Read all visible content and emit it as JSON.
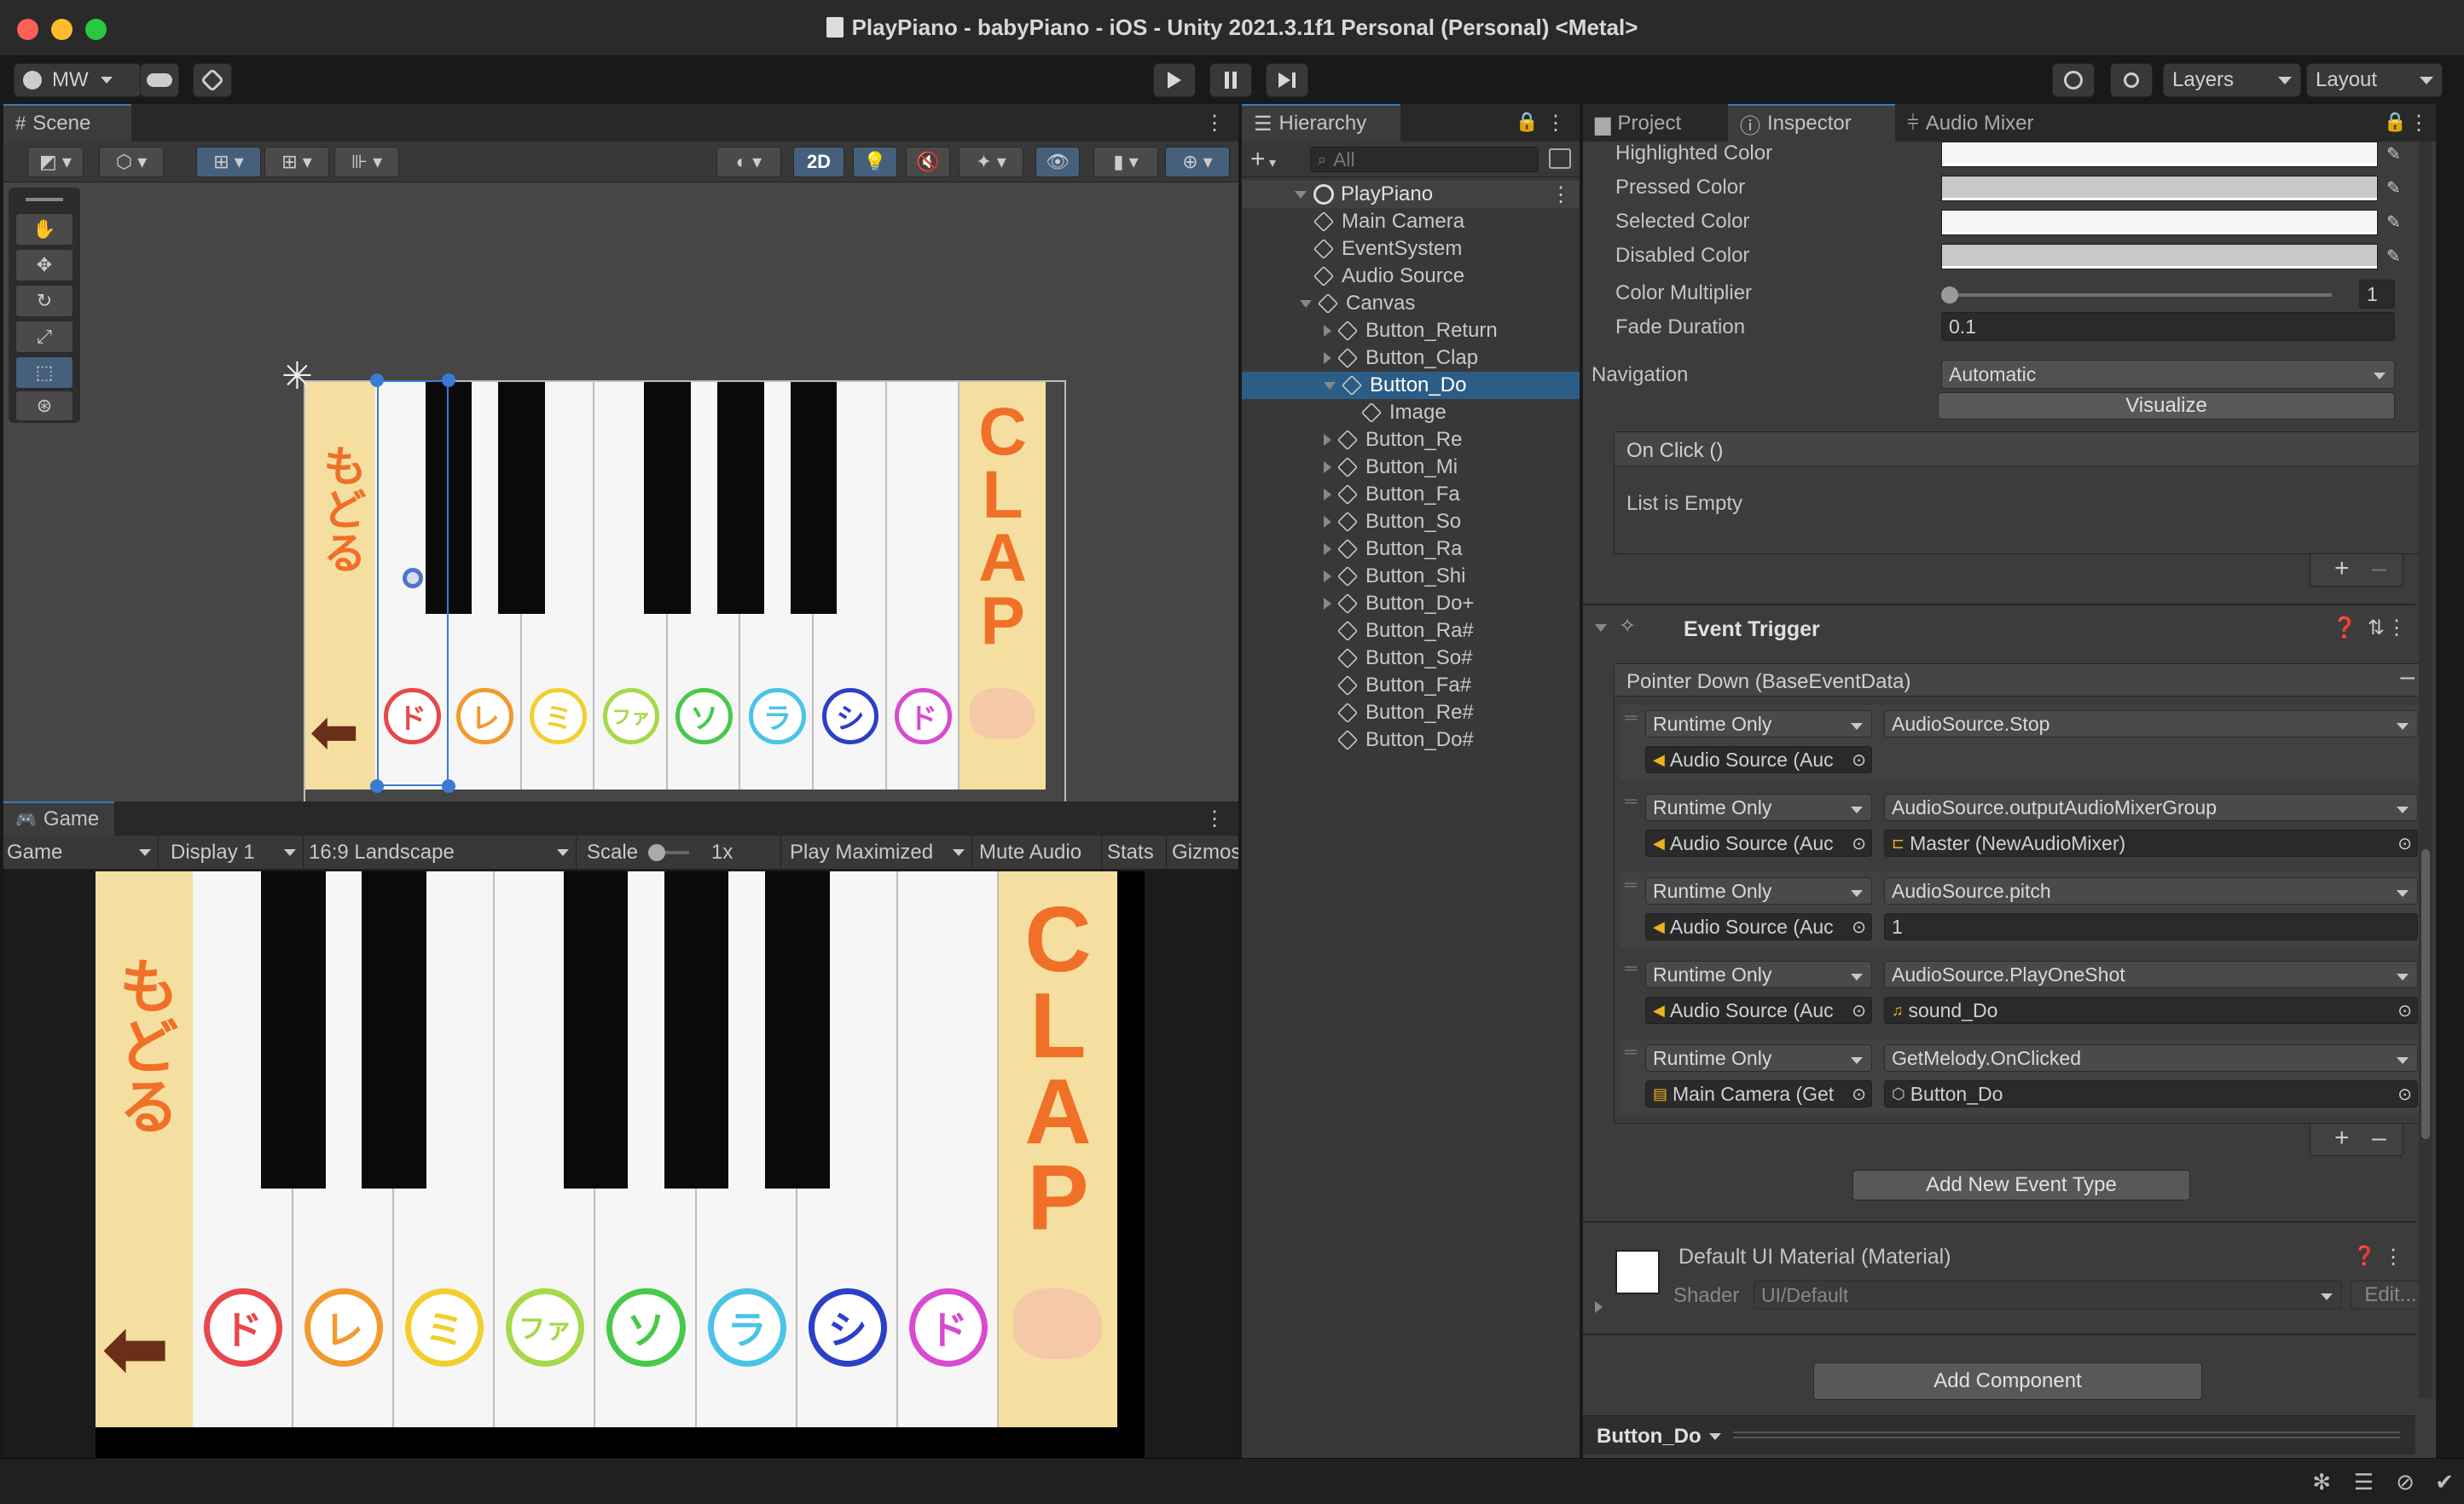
{
  "window": {
    "title": "PlayPiano - babyPiano - iOS - Unity 2021.3.1f1 Personal (Personal) <Metal>"
  },
  "colors": {
    "close": "#fe5f57",
    "minimize": "#febc2e",
    "maximize": "#28c840",
    "accent": "#3a79bb",
    "selection": "#2c5d87"
  },
  "toolbar": {
    "account": "MW",
    "layers": "Layers",
    "layout": "Layout"
  },
  "scene": {
    "tab": "Scene",
    "mode_2d": "2D"
  },
  "game": {
    "tab": "Game",
    "game_dropdown": "Game",
    "display": "Display 1",
    "aspect": "16:9 Landscape",
    "scale_label": "Scale",
    "scale_value": "1x",
    "play_mode": "Play Maximized",
    "mute": "Mute Audio",
    "stats": "Stats",
    "gizmos": "Gizmos"
  },
  "piano": {
    "back_text": "もどる",
    "clap_letters": [
      "C",
      "L",
      "A",
      "P"
    ],
    "notes": [
      {
        "glyph": "ド",
        "color": "#e8474b"
      },
      {
        "glyph": "レ",
        "color": "#f29a2e"
      },
      {
        "glyph": "ミ",
        "color": "#f2cf2e"
      },
      {
        "glyph": "ファ",
        "color": "#a6d94a"
      },
      {
        "glyph": "ソ",
        "color": "#47c94a"
      },
      {
        "glyph": "ラ",
        "color": "#4ac4e6"
      },
      {
        "glyph": "シ",
        "color": "#2b3fc9"
      },
      {
        "glyph": "ド",
        "color": "#d94ad0"
      }
    ]
  },
  "hierarchy": {
    "tab": "Hierarchy",
    "search_placeholder": "All",
    "root": "PlayPiano",
    "items": [
      {
        "label": "Main Camera",
        "depth": 1,
        "arrow": "none"
      },
      {
        "label": "EventSystem",
        "depth": 1,
        "arrow": "none"
      },
      {
        "label": "Audio Source",
        "depth": 1,
        "arrow": "none"
      },
      {
        "label": "Canvas",
        "depth": 1,
        "arrow": "down"
      },
      {
        "label": "Button_Return",
        "depth": 2,
        "arrow": "right"
      },
      {
        "label": "Button_Clap",
        "depth": 2,
        "arrow": "right"
      },
      {
        "label": "Button_Do",
        "depth": 2,
        "arrow": "down",
        "selected": true
      },
      {
        "label": "Image",
        "depth": 3,
        "arrow": "none"
      },
      {
        "label": "Button_Re",
        "depth": 2,
        "arrow": "right"
      },
      {
        "label": "Button_Mi",
        "depth": 2,
        "arrow": "right"
      },
      {
        "label": "Button_Fa",
        "depth": 2,
        "arrow": "right"
      },
      {
        "label": "Button_So",
        "depth": 2,
        "arrow": "right"
      },
      {
        "label": "Button_Ra",
        "depth": 2,
        "arrow": "right"
      },
      {
        "label": "Button_Shi",
        "depth": 2,
        "arrow": "right"
      },
      {
        "label": "Button_Do+",
        "depth": 2,
        "arrow": "right"
      },
      {
        "label": "Button_Ra#",
        "depth": 2,
        "arrow": "none"
      },
      {
        "label": "Button_So#",
        "depth": 2,
        "arrow": "none"
      },
      {
        "label": "Button_Fa#",
        "depth": 2,
        "arrow": "none"
      },
      {
        "label": "Button_Re#",
        "depth": 2,
        "arrow": "none"
      },
      {
        "label": "Button_Do#",
        "depth": 2,
        "arrow": "none"
      }
    ]
  },
  "inspector": {
    "tabs": [
      "Project",
      "Inspector",
      "Audio Mixer"
    ],
    "colors": [
      {
        "label": "Highlighted Color",
        "value": "#f5f5f5"
      },
      {
        "label": "Pressed Color",
        "value": "#c8c8c8"
      },
      {
        "label": "Selected Color",
        "value": "#f5f5f5"
      },
      {
        "label": "Disabled Color",
        "value": "#c8c8c8"
      }
    ],
    "color_multiplier_label": "Color Multiplier",
    "color_multiplier": "1",
    "fade_duration_label": "Fade Duration",
    "fade_duration": "0.1",
    "navigation_label": "Navigation",
    "navigation": "Automatic",
    "visualize": "Visualize",
    "on_click": "On Click ()",
    "list_empty": "List is Empty",
    "event_trigger": "Event Trigger",
    "pointer_down": "Pointer Down (BaseEventData)",
    "entries": [
      {
        "mode": "Runtime Only",
        "func": "AudioSource.Stop",
        "target": "Audio Source (Auc",
        "arg": ""
      },
      {
        "mode": "Runtime Only",
        "func": "AudioSource.outputAudioMixerGroup",
        "target": "Audio Source (Auc",
        "arg": "Master (NewAudioMixer)"
      },
      {
        "mode": "Runtime Only",
        "func": "AudioSource.pitch",
        "target": "Audio Source (Auc",
        "arg": "1"
      },
      {
        "mode": "Runtime Only",
        "func": "AudioSource.PlayOneShot",
        "target": "Audio Source (Auc",
        "arg": "sound_Do"
      },
      {
        "mode": "Runtime Only",
        "func": "GetMelody.OnClicked",
        "target": "Main Camera (Get",
        "arg": "Button_Do"
      }
    ],
    "add_event": "Add New Event Type",
    "material": "Default UI Material (Material)",
    "shader_label": "Shader",
    "shader": "UI/Default",
    "edit": "Edit...",
    "add_component": "Add Component",
    "footer": "Button_Do"
  }
}
